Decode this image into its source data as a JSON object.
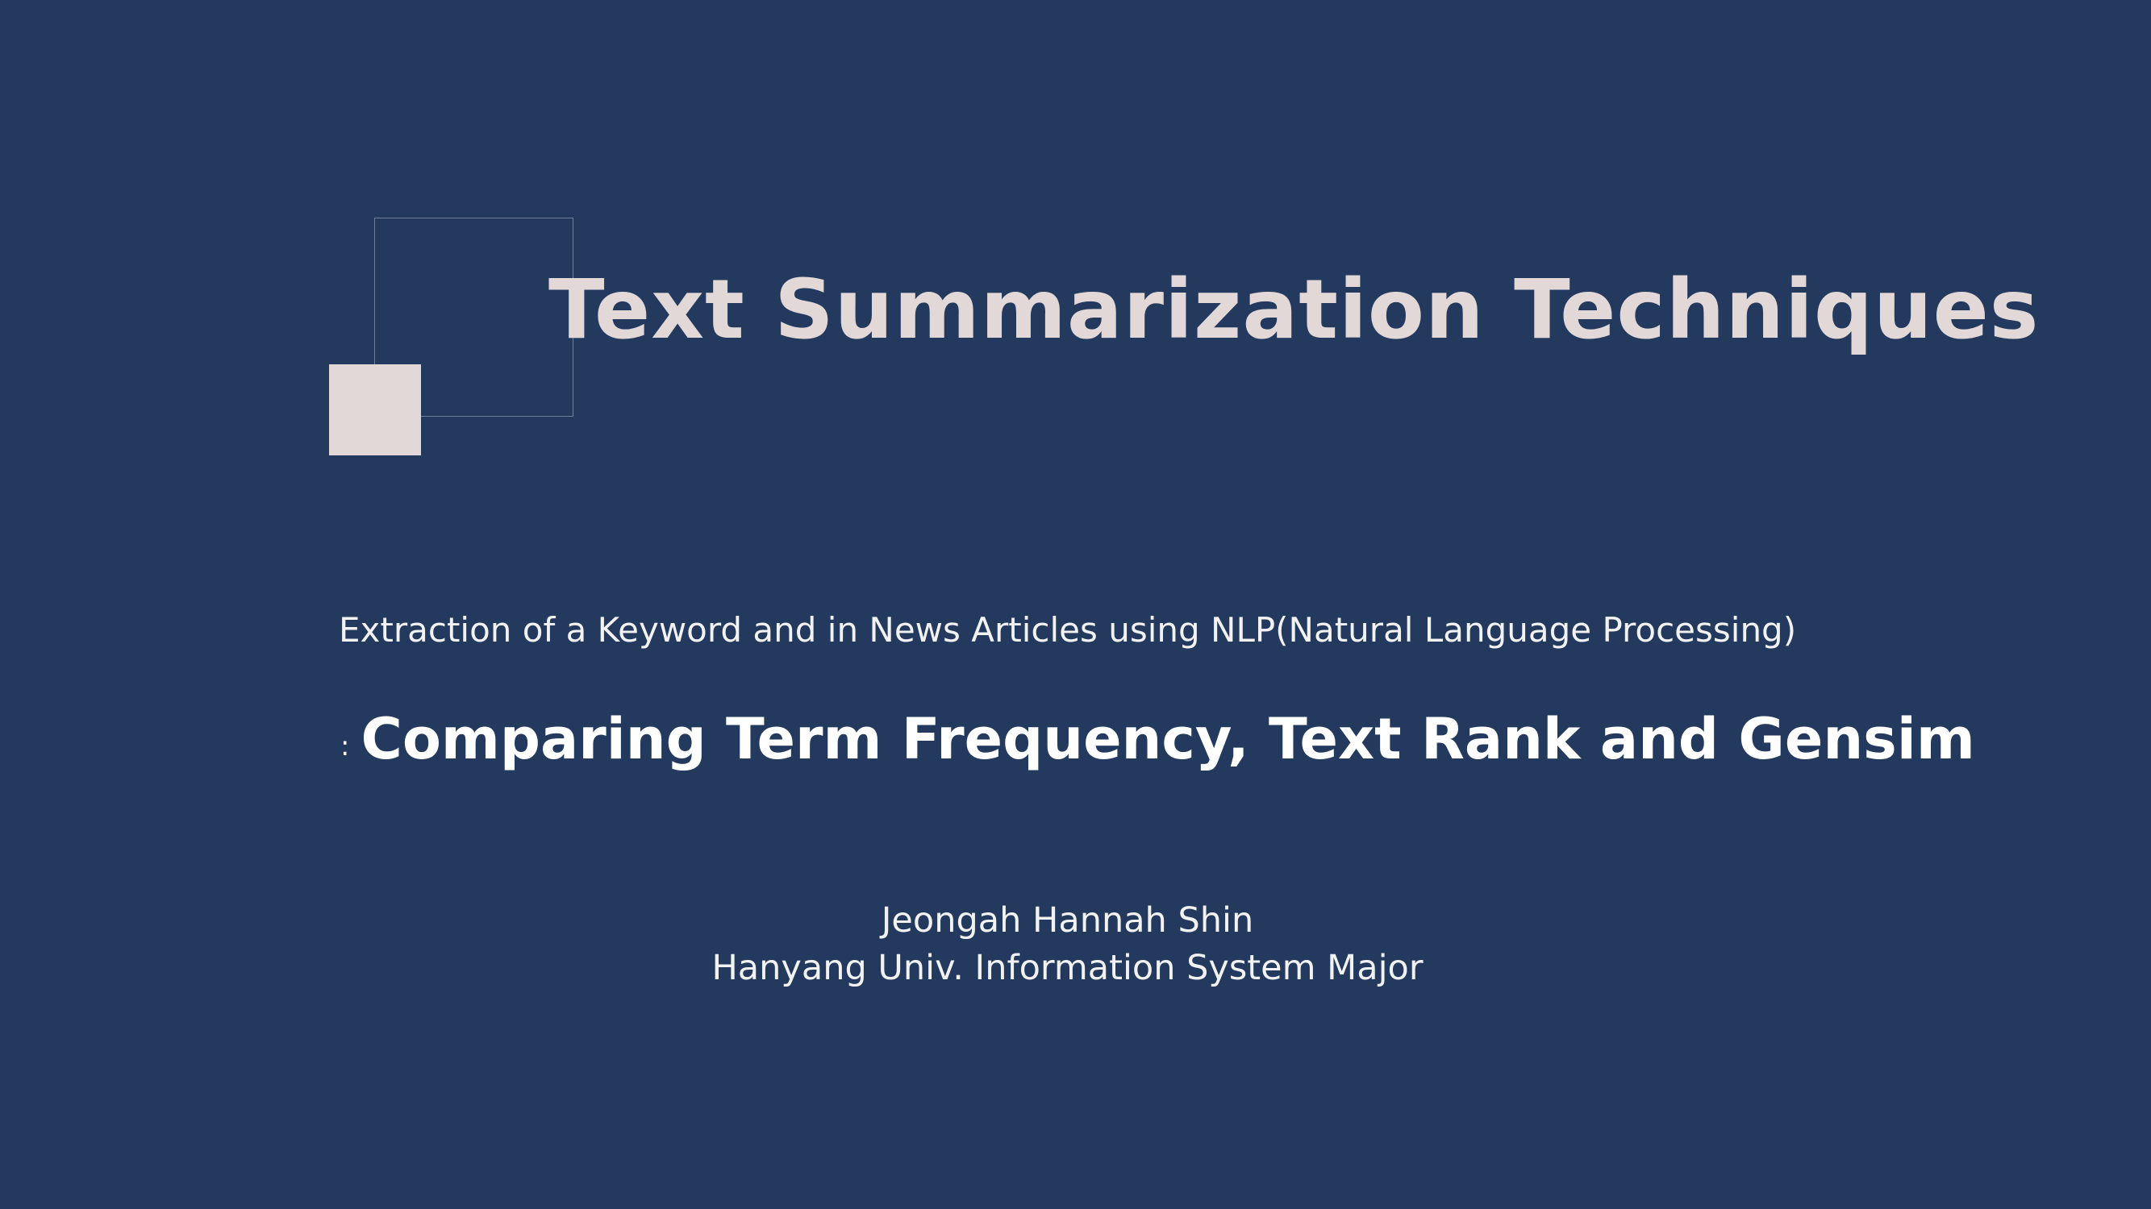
{
  "slide": {
    "title": "Text Summarization Techniques",
    "subtitle": "Extraction of a Keyword and in News Articles using NLP(Natural Language Processing)",
    "heading_prefix": ":",
    "heading": "Comparing Term Frequency, Text Rank and Gensim",
    "author_name": "Jeongah Hannah Shin",
    "author_affiliation": "Hanyang Univ. Information System Major"
  },
  "colors": {
    "background": "#233a5e",
    "accent": "#e2d8d8",
    "text": "#ffffff"
  }
}
